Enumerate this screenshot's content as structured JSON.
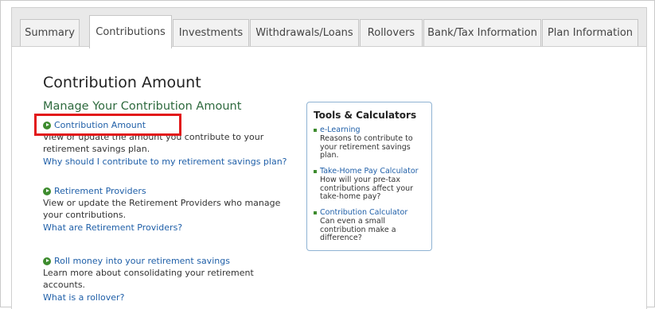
{
  "tabs": [
    {
      "label": "Summary"
    },
    {
      "label": "Contributions"
    },
    {
      "label": "Investments"
    },
    {
      "label": "Withdrawals/Loans"
    },
    {
      "label": "Rollovers"
    },
    {
      "label": "Bank/Tax Information"
    },
    {
      "label": "Plan Information"
    }
  ],
  "active_tab": "Contributions",
  "page": {
    "title": "Contribution Amount",
    "subtitle": "Manage Your Contribution Amount"
  },
  "sections": [
    {
      "link": "Contribution Amount",
      "desc": "View or update the amount you contribute to your retirement savings plan.",
      "help": "Why should I contribute to my retirement savings plan?"
    },
    {
      "link": "Retirement Providers",
      "desc": "View or update the Retirement Providers who manage your contributions.",
      "help": "What are Retirement Providers?"
    },
    {
      "link": "Roll money into your retirement savings",
      "desc": "Learn more about consolidating your retirement accounts.",
      "help": "What is a rollover?"
    }
  ],
  "tools": {
    "title": "Tools & Calculators",
    "items": [
      {
        "link": "e-Learning",
        "desc": "Reasons to contribute to your retirement savings plan."
      },
      {
        "link": "Take-Home Pay Calculator",
        "desc": "How will your pre-tax contributions affect your take-home pay?"
      },
      {
        "link": "Contribution Calculator",
        "desc": "Can even a small contribution make a difference?"
      }
    ]
  },
  "colors": {
    "link": "#1f5fa8",
    "heading_green": "#2e6a3e",
    "bullet_green": "#3d8b2e",
    "highlight_red": "#e2181a"
  }
}
